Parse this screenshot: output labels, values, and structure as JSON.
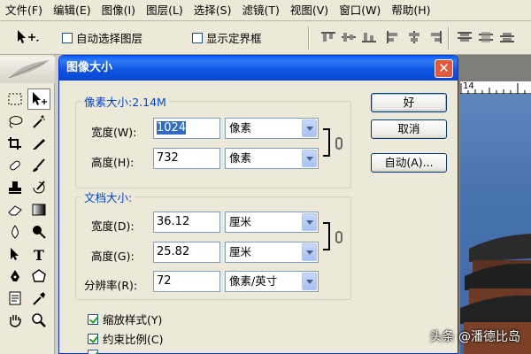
{
  "menubar": {
    "items": [
      "文件(F)",
      "编辑(E)",
      "图像(I)",
      "图层(L)",
      "选择(S)",
      "滤镜(T)",
      "视图(V)",
      "窗口(W)",
      "帮助(H)"
    ]
  },
  "options_bar": {
    "tool_icon": "move-tool-icon",
    "auto_select_label": "自动选择图层",
    "auto_select_checked": false,
    "show_bounds_label": "显示定界框",
    "show_bounds_checked": false
  },
  "toolbox": {
    "tools": [
      "marquee-icon",
      "move-icon",
      "lasso-icon",
      "magic-wand-icon",
      "crop-icon",
      "slice-icon",
      "healing-brush-icon",
      "brush-icon",
      "clone-stamp-icon",
      "history-brush-icon",
      "eraser-icon",
      "gradient-icon",
      "blur-icon",
      "dodge-icon",
      "path-select-icon",
      "type-icon",
      "pen-icon",
      "shape-icon",
      "notes-icon",
      "eyedropper-icon",
      "hand-icon",
      "zoom-icon"
    ]
  },
  "ruler": {
    "label": "14"
  },
  "dialog": {
    "title": "图像大小",
    "pixel_dims": {
      "legend": "像素大小:2.14M",
      "width_label": "宽度(W):",
      "width_value": "1024",
      "width_unit": "像素",
      "height_label": "高度(H):",
      "height_value": "732",
      "height_unit": "像素"
    },
    "doc_size": {
      "legend": "文档大小:",
      "width_label": "宽度(D):",
      "width_value": "36.12",
      "width_unit": "厘米",
      "height_label": "高度(G):",
      "height_value": "25.82",
      "height_unit": "厘米",
      "res_label": "分辨率(R):",
      "res_value": "72",
      "res_unit": "像素/英寸"
    },
    "checkboxes": {
      "scale_styles": {
        "label": "缩放样式(Y)",
        "checked": true
      },
      "constrain": {
        "label": "约束比例(C)",
        "checked": true
      }
    },
    "buttons": {
      "ok": "好",
      "cancel": "取消",
      "auto": "自动(A)..."
    }
  },
  "watermark": "头条 @潘德比岛",
  "colors": {
    "title_bar": "#0a5ef8",
    "legend": "#0046d5",
    "dialog_bg": "#ece9d8",
    "selection": "#316ac5"
  }
}
